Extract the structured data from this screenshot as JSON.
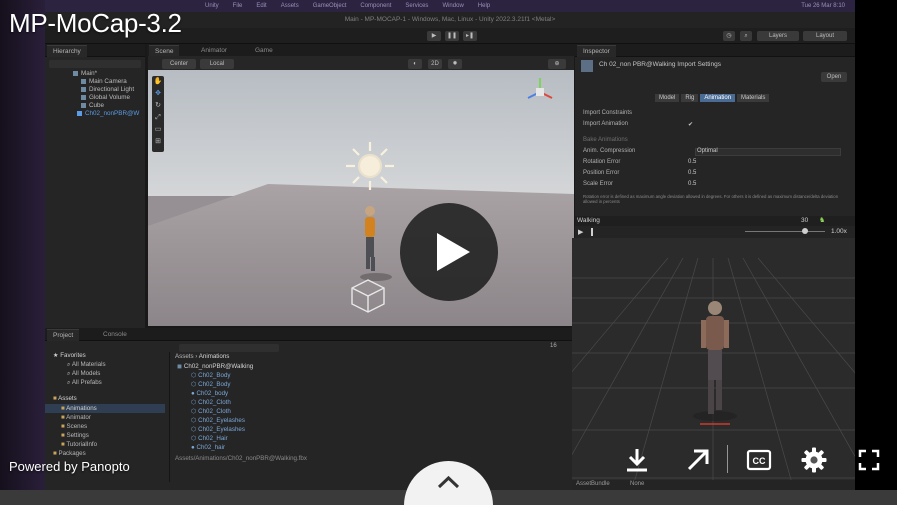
{
  "video": {
    "title": "MP-MoCap-3.2",
    "powered_by": "Powered by Panopto"
  },
  "unity": {
    "menubar": [
      "Unity",
      "File",
      "Edit",
      "Assets",
      "GameObject",
      "Component",
      "Services",
      "Window",
      "Help"
    ],
    "clock": "Tue 26 Mar 8:10",
    "window_title": "Main - MP-MOCAP-1 - Windows, Mac, Linux - Unity 2022.3.21f1 <Metal>",
    "toolbar": {
      "layers": "Layers",
      "layout": "Layout"
    },
    "hierarchy": {
      "tab": "Hierarchy",
      "items": [
        "Main*",
        "Main Camera",
        "Directional Light",
        "Global Volume",
        "Cube",
        "Ch02_nonPBR@W"
      ]
    },
    "scene_tabs": {
      "scene": "Scene",
      "animator": "Animator",
      "game": "Game"
    },
    "scene_toolbar": {
      "center": "Center",
      "local": "Local",
      "persp": "2D"
    },
    "inspector": {
      "tab": "Inspector",
      "header": "Ch 02_non PBR@Walking Import Settings",
      "open_button": "Open",
      "subtabs": [
        "Model",
        "Rig",
        "Animation",
        "Materials"
      ],
      "rows": [
        {
          "label": "Import Constraints",
          "value": ""
        },
        {
          "label": "Import Animation",
          "value": "✔"
        },
        {
          "label": "Bake Animations",
          "value": ""
        },
        {
          "label": "Anim. Compression",
          "value": "Optimal"
        },
        {
          "label": "Rotation Error",
          "value": "0.5"
        },
        {
          "label": "Position Error",
          "value": "0.5"
        },
        {
          "label": "Scale Error",
          "value": "0.5"
        }
      ],
      "note": "Rotation error is defined as maximum angle deviation allowed in degrees. For others it is defined as maximum distance/delta deviation allowed in percents"
    },
    "preview": {
      "clip_name": "Walking",
      "speed": "1.00x",
      "frame": "30"
    },
    "project": {
      "tabs": [
        "Project",
        "Console"
      ],
      "favorites": [
        "Favorites",
        "All Materials",
        "All Models",
        "All Prefabs"
      ],
      "assets_tree": [
        "Assets",
        "Animations",
        "Animator",
        "Scenes",
        "Settings",
        "TutorialInfo",
        "Packages"
      ],
      "breadcrumb": [
        "Assets",
        "Animations"
      ],
      "files": [
        "Ch02_nonPBR@Walking",
        "Ch02_Body",
        "Ch02_Body",
        "Ch02_body",
        "Ch02_Cloth",
        "Ch02_Cloth",
        "Ch02_Eyelashes",
        "Ch02_Eyelashes",
        "Ch02_Hair",
        "Ch02_hair"
      ],
      "path_bar": "Assets/Animations/Ch02_nonPBR@Walking.fbx",
      "count": "16",
      "assetbundle_label": "AssetBundle",
      "assetbundle_value": "None"
    }
  },
  "controls": [
    "download-icon",
    "open-external-icon",
    "closed-captions-icon",
    "settings-gear-icon",
    "fullscreen-icon",
    "expand-up-icon",
    "play-icon"
  ]
}
